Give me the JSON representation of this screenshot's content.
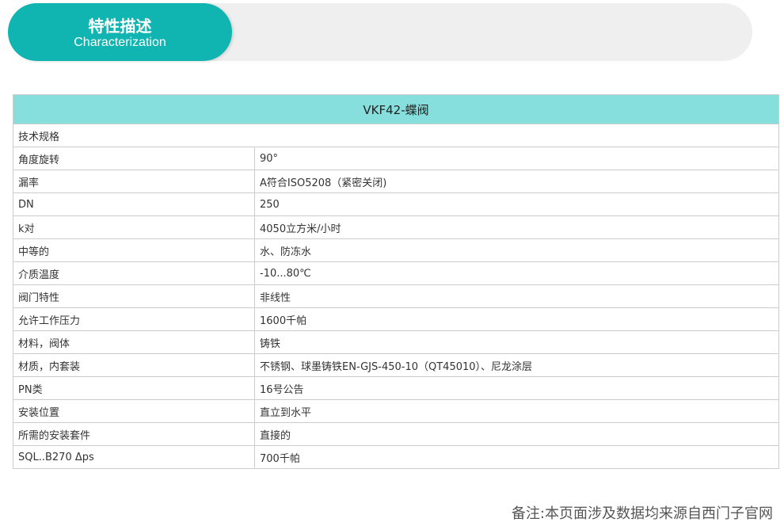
{
  "header": {
    "title": "特性描述",
    "subtitle": "Characterization"
  },
  "table": {
    "title": "VKF42-蝶阀",
    "section_label": "技术规格",
    "rows": [
      {
        "label": "角度旋转",
        "value": "90°"
      },
      {
        "label": "漏率",
        "value": "A符合ISO5208（紧密关闭)"
      },
      {
        "label": "DN",
        "value": "250"
      },
      {
        "label": "k对",
        "value": "4050立方米/小时"
      },
      {
        "label": "中等的",
        "value": "水、防冻水"
      },
      {
        "label": "介质温度",
        "value": "-10...80℃"
      },
      {
        "label": "阀门特性",
        "value": "非线性"
      },
      {
        "label": "允许工作压力",
        "value": "1600千帕"
      },
      {
        "label": "材料，阀体",
        "value": "铸铁"
      },
      {
        "label": "材质，内套装",
        "value": "不锈钢、球墨铸铁EN-GJS-450-10（QT45010）、尼龙涂层"
      },
      {
        "label": "PN类",
        "value": "16号公告"
      },
      {
        "label": "安装位置",
        "value": "直立到水平"
      },
      {
        "label": "所需的安装套件",
        "value": "直接的"
      },
      {
        "label": "SQL..B270 Δps",
        "value": "700千帕"
      }
    ]
  },
  "footer": {
    "note": "备注:本页面涉及数据均来源自西门子官网"
  }
}
